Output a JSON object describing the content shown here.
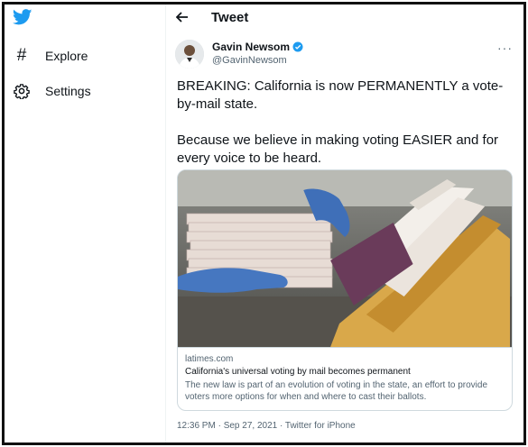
{
  "sidebar": {
    "logo_icon": "twitter-bird-icon",
    "items": [
      {
        "label": "Explore",
        "icon": "hashtag-icon"
      },
      {
        "label": "Settings",
        "icon": "gear-icon"
      }
    ]
  },
  "header": {
    "back_icon": "back-arrow-icon",
    "title": "Tweet"
  },
  "tweet": {
    "author_name": "Gavin Newsom",
    "author_handle": "@GavinNewsom",
    "verified": true,
    "more_label": "···",
    "paragraphs": [
      "BREAKING: California is now PERMANENTLY a vote-by-mail state.",
      "Because we believe in making voting EASIER and for every voice to be heard."
    ],
    "card": {
      "domain": "latimes.com",
      "title": "California's universal voting by mail becomes permanent",
      "description": "The new law is part of an evolution of voting in the state, an effort to provide voters more options for when and where to cast their ballots."
    },
    "timestamp": "12:36 PM · Sep 27, 2021 · Twitter for iPhone"
  },
  "colors": {
    "brand": "#1d9bf0",
    "text": "#0f1419",
    "muted": "#536471",
    "border": "#cfd9de"
  }
}
